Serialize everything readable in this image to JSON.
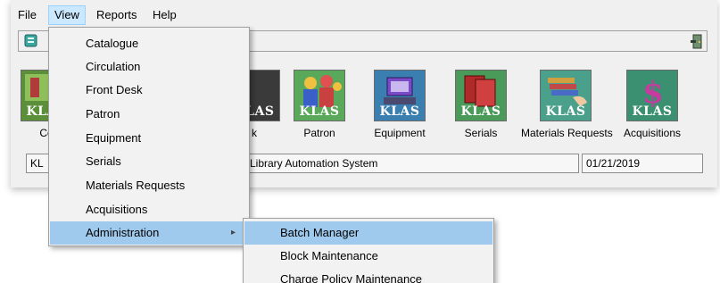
{
  "menubar": {
    "file": "File",
    "view": "View",
    "reports": "Reports",
    "help": "Help"
  },
  "view_menu": {
    "items": [
      {
        "label": "Catalogue"
      },
      {
        "label": "Circulation"
      },
      {
        "label": "Front Desk"
      },
      {
        "label": "Patron"
      },
      {
        "label": "Equipment"
      },
      {
        "label": "Serials"
      },
      {
        "label": "Materials Requests"
      },
      {
        "label": "Acquisitions"
      },
      {
        "label": "Administration",
        "highlighted": true,
        "has_submenu": true
      }
    ]
  },
  "administration_submenu": {
    "items": [
      {
        "label": "Batch Manager",
        "highlighted": true
      },
      {
        "label": "Block Maintenance"
      },
      {
        "label": "Charge Policy Maintenance"
      }
    ]
  },
  "modules": {
    "badge": "KLAS",
    "items": [
      {
        "label": "Co"
      },
      {
        "label": "k"
      },
      {
        "label": "Patron"
      },
      {
        "label": "Equipment"
      },
      {
        "label": "Serials"
      },
      {
        "label": "Materials Requests"
      },
      {
        "label": "Acquisitions"
      }
    ]
  },
  "status": {
    "left": "KL",
    "center": "Library Automation System",
    "date": "01/21/2019"
  },
  "icons": {
    "toolbar_left": "document-icon",
    "toolbar_right": "exit-door-icon"
  },
  "colors": {
    "menu_highlight": "#9fcaee",
    "menubar_active": "#cce8ff",
    "klas_text": "#ffffff"
  }
}
